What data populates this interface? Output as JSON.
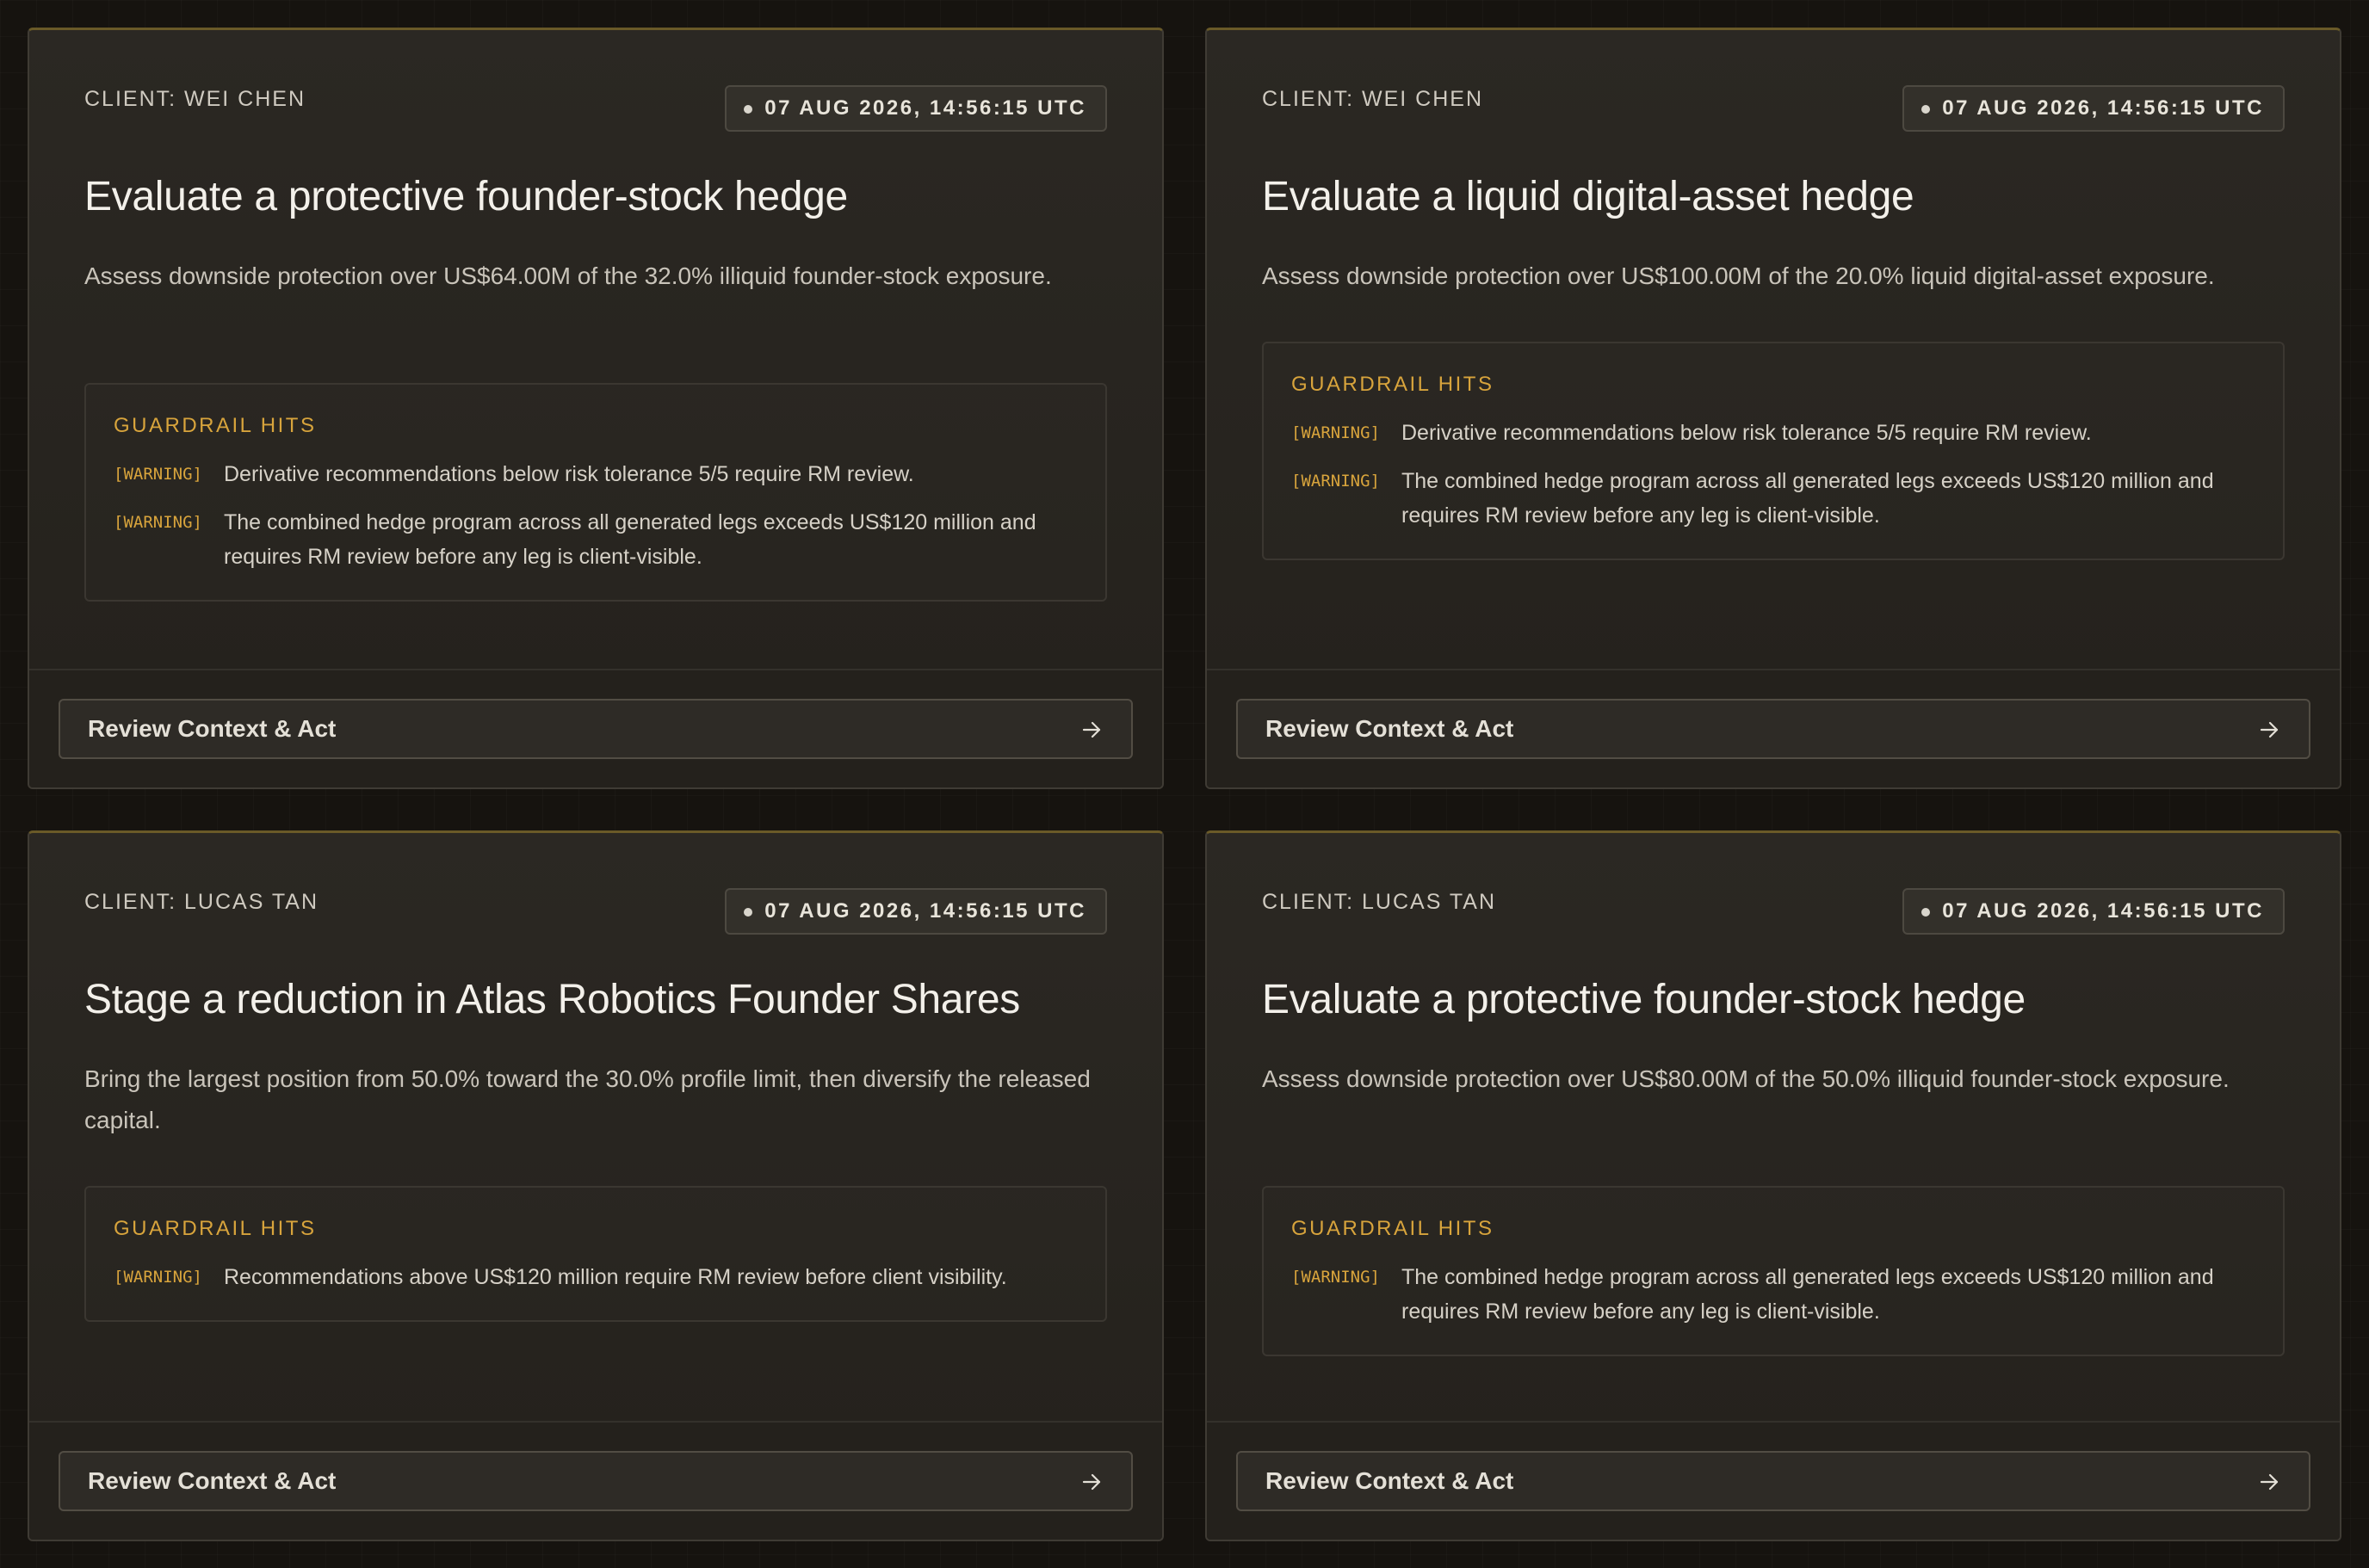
{
  "cards": [
    {
      "client": "CLIENT: WEI CHEN",
      "timestamp": "07 AUG 2026, 14:56:15 UTC",
      "title": "Evaluate a protective founder-stock hedge",
      "description": "Assess downside protection over US$64.00M of the 32.0% illiquid founder-stock exposure.",
      "guardrail_title": "GUARDRAIL HITS",
      "hits": [
        {
          "level": "[WARNING]",
          "text": "Derivative recommendations below risk tolerance 5/5 require RM review."
        },
        {
          "level": "[WARNING]",
          "text": "The combined hedge program across all generated legs exceeds US$120 million and requires RM review before any leg is client-visible."
        }
      ],
      "action_label": "Review Context & Act"
    },
    {
      "client": "CLIENT: WEI CHEN",
      "timestamp": "07 AUG 2026, 14:56:15 UTC",
      "title": "Evaluate a liquid digital-asset hedge",
      "description": "Assess downside protection over US$100.00M of the 20.0% liquid digital-asset exposure.",
      "guardrail_title": "GUARDRAIL HITS",
      "hits": [
        {
          "level": "[WARNING]",
          "text": "Derivative recommendations below risk tolerance 5/5 require RM review."
        },
        {
          "level": "[WARNING]",
          "text": "The combined hedge program across all generated legs exceeds US$120 million and requires RM review before any leg is client-visible."
        }
      ],
      "action_label": "Review Context & Act"
    },
    {
      "client": "CLIENT: LUCAS TAN",
      "timestamp": "07 AUG 2026, 14:56:15 UTC",
      "title": "Stage a reduction in Atlas Robotics Founder Shares",
      "description": "Bring the largest position from 50.0% toward the 30.0% profile limit, then diversify the released capital.",
      "guardrail_title": "GUARDRAIL HITS",
      "hits": [
        {
          "level": "[WARNING]",
          "text": "Recommendations above US$120 million require RM review before client visibility."
        }
      ],
      "action_label": "Review Context & Act"
    },
    {
      "client": "CLIENT: LUCAS TAN",
      "timestamp": "07 AUG 2026, 14:56:15 UTC",
      "title": "Evaluate a protective founder-stock hedge",
      "description": "Assess downside protection over US$80.00M of the 50.0% illiquid founder-stock exposure.",
      "guardrail_title": "GUARDRAIL HITS",
      "hits": [
        {
          "level": "[WARNING]",
          "text": "The combined hedge program across all generated legs exceeds US$120 million and requires RM review before any leg is client-visible."
        }
      ],
      "action_label": "Review Context & Act"
    }
  ],
  "colors": {
    "accent": "#d8a43c",
    "background": "#16130f",
    "card": "#2b2823"
  },
  "icons": {
    "action": "arrow-right-icon",
    "timestamp": "status-dot-icon"
  }
}
